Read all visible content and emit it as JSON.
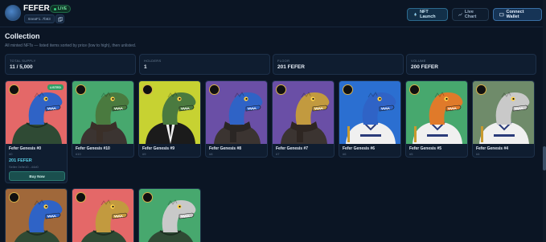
{
  "header": {
    "title": "FEFER",
    "live_label": "LIVE",
    "address": "6neaF1..7b63",
    "buttons": {
      "nft_launch": "NFT Launch",
      "live_chart": "Live Chart",
      "connect_wallet": "Connect Wallet"
    }
  },
  "collection": {
    "title": "Collection",
    "subtitle": "All minted NFTs — listed items sorted by price (low to high), then unlisted."
  },
  "stats": [
    {
      "label": "TOTAL SUPPLY",
      "value": "11 / 5,000"
    },
    {
      "label": "HOLDERS",
      "value": "1"
    },
    {
      "label": "FLOOR",
      "value": "201 FEFER"
    },
    {
      "label": "VOLUME",
      "value": "200 FEFER"
    }
  ],
  "cards": [
    {
      "name": "Fefer Genesis #0",
      "id": "#0",
      "listed_label": "LISTED",
      "price": "201 FEFER",
      "seller": "Seller 0x9e10...44d0",
      "buy_label": "Buy Now",
      "bg": "#e46868",
      "skin": "#2f63c6",
      "outfit": "hoodie",
      "outfit_color": "#2f4a34"
    },
    {
      "name": "Fefer Genesis #10",
      "id": "#10",
      "bg": "#47a86e",
      "skin": "#4a7a3f",
      "outfit": "scarf",
      "outfit_color": "#3a2f28"
    },
    {
      "name": "Fefer Genesis #9",
      "id": "#9",
      "bg": "#c7d232",
      "skin": "#4a7a3f",
      "outfit": "suit",
      "outfit_color": "#1b1b1b"
    },
    {
      "name": "Fefer Genesis #8",
      "id": "#8",
      "bg": "#6a4fa6",
      "skin": "#2f63c6",
      "outfit": "scarf",
      "outfit_color": "#2a2624"
    },
    {
      "name": "Fefer Genesis #7",
      "id": "#7",
      "bg": "#6a4fa6",
      "skin": "#c29a3f",
      "outfit": "scarf",
      "outfit_color": "#2e2622"
    },
    {
      "name": "Fefer Genesis #6",
      "id": "#6",
      "bg": "#2b6fd1",
      "skin": "#2f63c6",
      "outfit": "jersey",
      "outfit_color": "#f0f0f0"
    },
    {
      "name": "Fefer Genesis #5",
      "id": "#5",
      "bg": "#47a86e",
      "skin": "#e07a2a",
      "outfit": "jersey",
      "outfit_color": "#f0f0f0"
    },
    {
      "name": "Fefer Genesis #4",
      "id": "#4",
      "bg": "#6f8b6a",
      "skin": "#c9c9c9",
      "outfit": "jersey",
      "outfit_color": "#f0f0f0"
    },
    {
      "name": "",
      "id": "",
      "bg": "#a0683a",
      "skin": "#2f63c6",
      "outfit": "hoodie",
      "outfit_color": "#2f4a34"
    },
    {
      "name": "",
      "id": "",
      "bg": "#e46868",
      "skin": "#c29a3f",
      "outfit": "hoodie",
      "outfit_color": "#2f4a34"
    },
    {
      "name": "",
      "id": "",
      "bg": "#47a86e",
      "skin": "#c9c9c9",
      "outfit": "hoodie",
      "outfit_color": "#2f4a34"
    }
  ]
}
